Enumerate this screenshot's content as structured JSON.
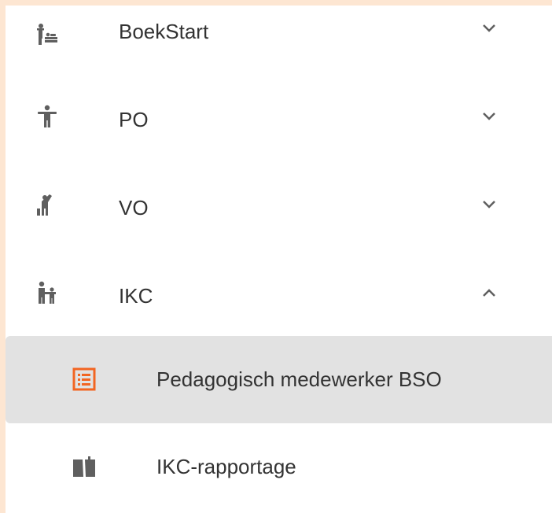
{
  "menu": {
    "items": [
      {
        "label": "BoekStart",
        "icon": "baby-changing-icon",
        "expanded": false
      },
      {
        "label": "PO",
        "icon": "child-icon",
        "expanded": false
      },
      {
        "label": "VO",
        "icon": "student-waving-icon",
        "expanded": false
      },
      {
        "label": "IKC",
        "icon": "parent-child-icon",
        "expanded": true
      }
    ],
    "subitems": [
      {
        "label": "Pedagogisch medewerker BSO",
        "icon": "list-icon",
        "active": true
      },
      {
        "label": "IKC-rapportage",
        "icon": "book-open-icon",
        "active": false
      }
    ]
  },
  "colors": {
    "frame": "#fde6d2",
    "icon": "#5f5f5f",
    "active_bg": "#e2e2e2",
    "active_icon": "#f26522",
    "text": "#333333"
  }
}
